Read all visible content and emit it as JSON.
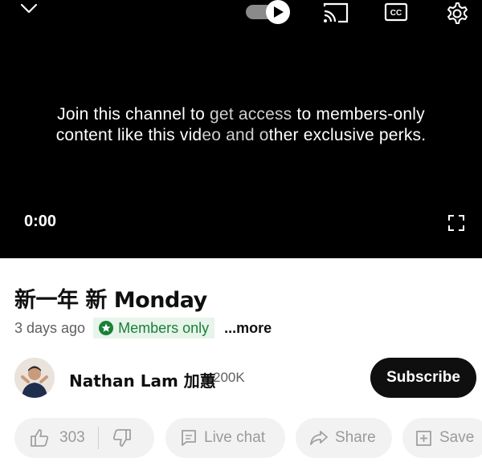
{
  "player": {
    "message_line1_a": "Join this channel to ",
    "message_line1_b": "get access",
    "message_line1_c": " to members-only",
    "message_line2_a": "content like this vid",
    "message_line2_b": "eo and o",
    "message_line2_c": "ther exclusive perks.",
    "time": "0:00",
    "autoplay_on": true,
    "icons": [
      "chevron-down-icon",
      "autoplay-toggle-icon",
      "cast-icon",
      "captions-icon",
      "settings-icon",
      "fullscreen-icon"
    ]
  },
  "video": {
    "title": "新一年 新 Monday",
    "age": "3 days ago",
    "members_label": "Members only",
    "more_label": "...more"
  },
  "channel": {
    "name": "Nathan Lam 加蕙",
    "subscribers": "200K",
    "subscribe_label": "Subscribe"
  },
  "actions": {
    "likes": "303",
    "live_chat": "Live chat",
    "share": "Share",
    "save": "Save"
  },
  "colors": {
    "members_bg": "#e6f4ea",
    "members_text": "#1a7f37",
    "subscribe_bg": "#0f0f0f"
  }
}
